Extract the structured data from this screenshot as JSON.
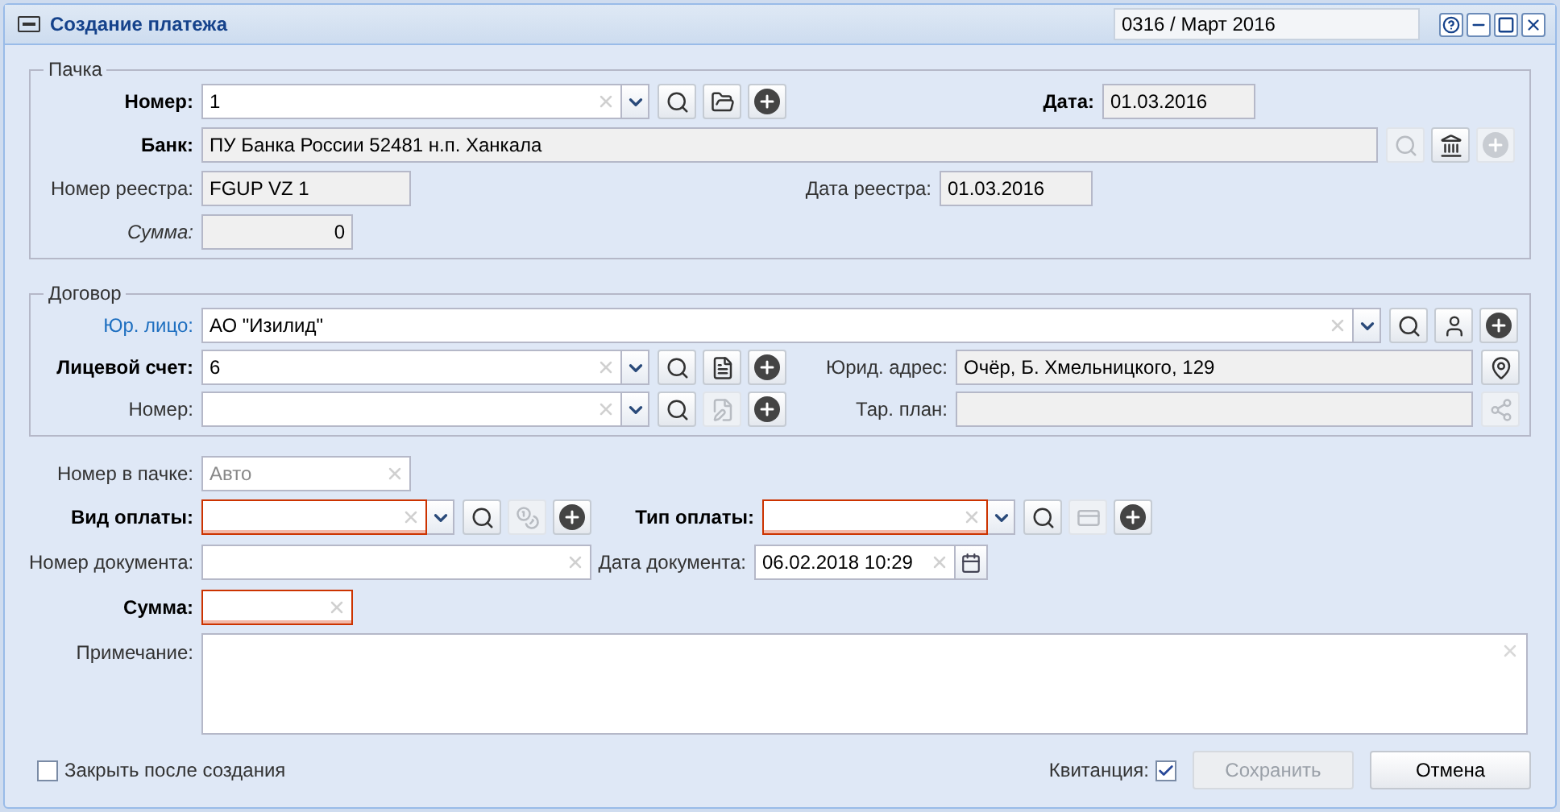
{
  "window": {
    "title": "Создание платежа",
    "period": "0316 / Март 2016"
  },
  "batch": {
    "legend": "Пачка",
    "number": {
      "label": {
        "text": "Номер:",
        "kind": "bold"
      },
      "kind": "combo",
      "value": "1",
      "invalid": false,
      "tools": [
        {
          "kind": "search",
          "disabled": false
        },
        {
          "kind": "folder",
          "disabled": false
        },
        {
          "kind": "add",
          "disabled": false
        }
      ]
    },
    "date": {
      "label": {
        "text": "Дата:",
        "kind": "bold"
      },
      "kind": "readonly",
      "value": "01.03.2016"
    },
    "bank": {
      "label": {
        "text": "Банк:",
        "kind": "bold"
      },
      "kind": "readonly",
      "value": "ПУ Банка России 52481 н.п. Ханкала",
      "tools": [
        {
          "kind": "search",
          "disabled": true
        },
        {
          "kind": "bank",
          "disabled": false
        },
        {
          "kind": "add",
          "disabled": true
        }
      ]
    },
    "registry_number": {
      "label": {
        "text": "Номер реестра:",
        "kind": "plain"
      },
      "kind": "readonly",
      "value": "FGUP VZ 1"
    },
    "registry_date": {
      "label": {
        "text": "Дата реестра:",
        "kind": "plain"
      },
      "kind": "readonly",
      "value": "01.03.2016"
    },
    "sum": {
      "label": {
        "text": "Сумма:",
        "kind": "italic"
      },
      "kind": "amount",
      "value": "0"
    }
  },
  "contract": {
    "legend": "Договор",
    "legal_entity": {
      "label": {
        "text": "Юр. лицо:",
        "kind": "link"
      },
      "kind": "combo",
      "value": "АО \"Изилид\"",
      "invalid": false,
      "tools": [
        {
          "kind": "search",
          "disabled": false
        },
        {
          "kind": "person",
          "disabled": false
        },
        {
          "kind": "add",
          "disabled": false
        }
      ]
    },
    "account": {
      "label": {
        "text": "Лицевой счет:",
        "kind": "bold"
      },
      "kind": "combo",
      "value": "6",
      "invalid": false,
      "tools": [
        {
          "kind": "search",
          "disabled": false
        },
        {
          "kind": "card",
          "disabled": false
        },
        {
          "kind": "add",
          "disabled": false
        }
      ]
    },
    "address": {
      "label": {
        "text": "Юрид. адрес:",
        "kind": "plain"
      },
      "kind": "readonly",
      "value": "Очёр, Б. Хмельницкого, 129",
      "tools": [
        {
          "kind": "pin",
          "disabled": false
        }
      ]
    },
    "number": {
      "label": {
        "text": "Номер:",
        "kind": "plain"
      },
      "kind": "combo",
      "invalid": false,
      "tools": [
        {
          "kind": "search",
          "disabled": false
        },
        {
          "kind": "edit",
          "disabled": true
        },
        {
          "kind": "add",
          "disabled": false
        }
      ]
    },
    "tariff": {
      "label": {
        "text": "Тар. план:",
        "kind": "plain"
      },
      "kind": "readonly",
      "tools": [
        {
          "kind": "network",
          "disabled": true
        }
      ]
    }
  },
  "payment": {
    "batch_number": {
      "label": {
        "text": "Номер в пачке:",
        "kind": "plain"
      },
      "kind": "text",
      "placeholder": "Авто",
      "invalid": false
    },
    "payment_kind": {
      "label": {
        "text": "Вид оплаты:",
        "kind": "bold"
      },
      "kind": "combo",
      "invalid": true,
      "tools": [
        {
          "kind": "search",
          "disabled": false
        },
        {
          "kind": "bag",
          "disabled": true
        },
        {
          "kind": "add",
          "disabled": false
        }
      ]
    },
    "payment_type": {
      "label": {
        "text": "Тип оплаты:",
        "kind": "bold"
      },
      "kind": "combo",
      "invalid": true,
      "tools": [
        {
          "kind": "search",
          "disabled": false
        },
        {
          "kind": "coin",
          "disabled": true
        },
        {
          "kind": "add",
          "disabled": false
        }
      ]
    },
    "document_number": {
      "label": {
        "text": "Номер документа:",
        "kind": "plain"
      },
      "kind": "text",
      "invalid": false
    },
    "document_date": {
      "label": {
        "text": "Дата документа:",
        "kind": "plain"
      },
      "kind": "date",
      "value": "06.02.2018 10:29",
      "invalid": false
    },
    "sum": {
      "label": {
        "text": "Сумма:",
        "kind": "bold"
      },
      "kind": "text",
      "invalid": true
    },
    "note": {
      "label": {
        "text": "Примечание:",
        "kind": "plain"
      },
      "kind": "textarea",
      "invalid": false
    }
  },
  "footer": {
    "close_after": {
      "label": "Закрыть после создания",
      "checked": false
    },
    "receipt": {
      "label": "Квитанция:",
      "checked": true
    },
    "buttons": [
      {
        "label": "Сохранить",
        "disabled": true
      },
      {
        "label": "Отмена",
        "disabled": false
      }
    ]
  }
}
